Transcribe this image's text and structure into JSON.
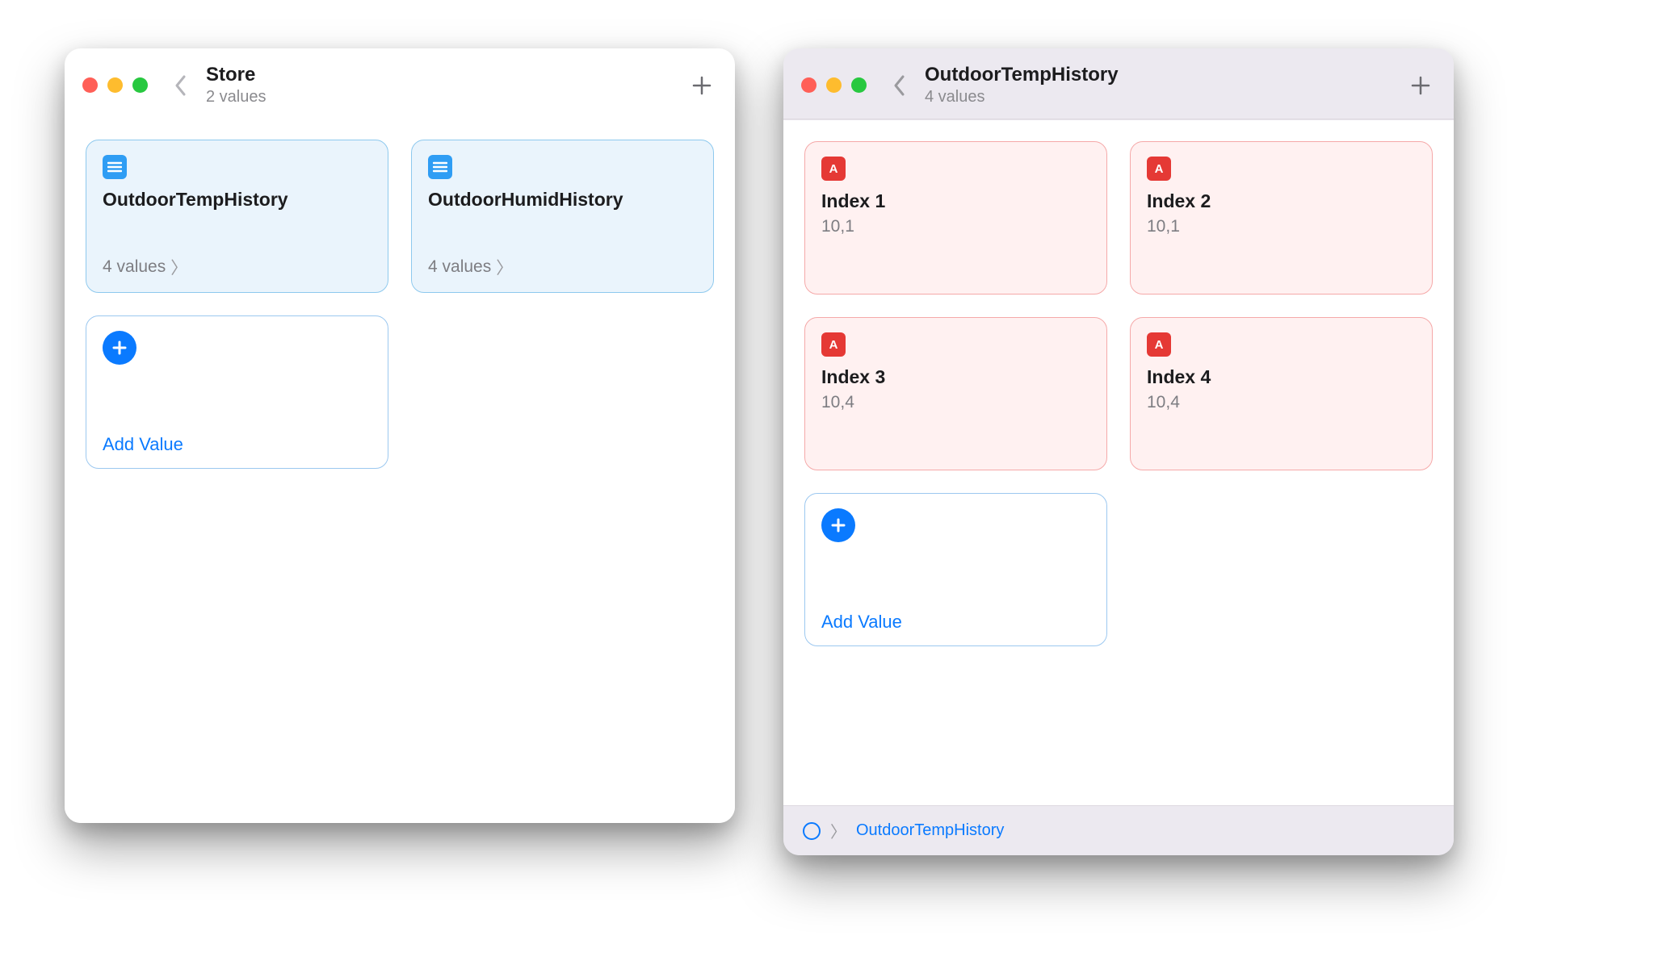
{
  "leftWindow": {
    "title": "Store",
    "subtitle": "2 values",
    "cards": [
      {
        "icon": "list",
        "title": "OutdoorTempHistory",
        "footer": "4 values"
      },
      {
        "icon": "list",
        "title": "OutdoorHumidHistory",
        "footer": "4 values"
      }
    ],
    "addLabel": "Add Value"
  },
  "rightWindow": {
    "title": "OutdoorTempHistory",
    "subtitle": "4 values",
    "cards": [
      {
        "badge": "A",
        "title": "Index 1",
        "value": "10,1"
      },
      {
        "badge": "A",
        "title": "Index 2",
        "value": "10,1"
      },
      {
        "badge": "A",
        "title": "Index 3",
        "value": "10,4"
      },
      {
        "badge": "A",
        "title": "Index 4",
        "value": "10,4"
      }
    ],
    "addLabel": "Add Value",
    "breadcrumb": "OutdoorTempHistory"
  }
}
